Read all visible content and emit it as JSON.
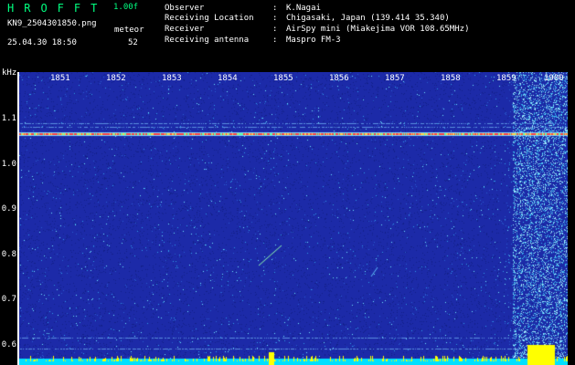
{
  "header": {
    "app_title": "HROFFT",
    "version": "1.00f",
    "filename": "KN9_2504301850.png",
    "meteor_label": "meteor",
    "datetime": "25.04.30 18:50",
    "meteor_count": "52"
  },
  "info": [
    {
      "key": "Observer",
      "value": "K.Nagai"
    },
    {
      "key": "Receiving Location",
      "value": "Chigasaki, Japan (139.414 35.340)"
    },
    {
      "key": "Receiver",
      "value": "AirSpy mini (Miakejima VOR 108.65MHz)"
    },
    {
      "key": "Receiving antenna",
      "value": "Maspro FM-3"
    }
  ],
  "separator": ":",
  "axis": {
    "unit": "kHz",
    "x_ticks": [
      "1851",
      "1852",
      "1853",
      "1854",
      "1855",
      "1856",
      "1857",
      "1858",
      "1859",
      "1900"
    ],
    "y_ticks": [
      "1.1",
      "1.0",
      "0.9",
      "0.8",
      "0.7",
      "0.6"
    ]
  },
  "colors": {
    "title": "#00ff80",
    "text": "#ffffff",
    "background": "#000000",
    "noise_floor": "#1c2aa8",
    "signal_line": "#ff4040",
    "baseline": "#00e0ff",
    "tick_marks": "#ffff00"
  }
}
